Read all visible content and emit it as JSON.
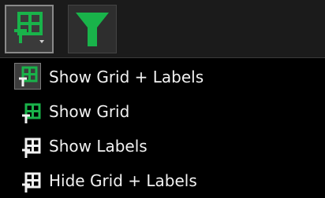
{
  "toolbar": {
    "buttons": [
      {
        "icon": "grid-labels-icon",
        "state": "selected"
      },
      {
        "icon": "filter-icon",
        "color": "#19b34a"
      }
    ]
  },
  "menu": {
    "items": [
      {
        "label": "Show Grid + Labels",
        "icon": "grid-labels-icon",
        "active": true
      },
      {
        "label": "Show Grid",
        "icon": "grid-icon",
        "active": false
      },
      {
        "label": "Show Labels",
        "icon": "labels-icon",
        "active": false
      },
      {
        "label": "Hide Grid + Labels",
        "icon": "hide-grid-labels-icon",
        "active": false
      }
    ]
  },
  "colors": {
    "accent_green": "#19b34a",
    "icon_white": "#f2f2f2",
    "menu_bg": "#000000",
    "toolbar_bg": "#1b1b1b"
  }
}
